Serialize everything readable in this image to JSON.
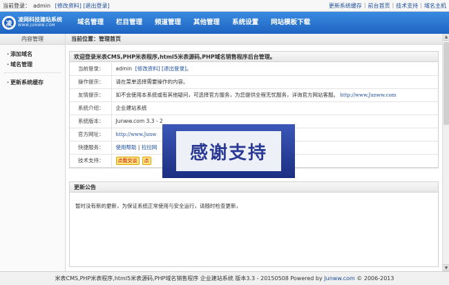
{
  "topbar": {
    "login_label": "当前登录：",
    "user": "admin",
    "edit_profile": "[修改资料]",
    "logout": "[退出登录]",
    "links": [
      "更新系统缓存",
      "前台首页",
      "技术支持",
      "域名主机"
    ]
  },
  "logo": {
    "mark": "凌",
    "name": "凌网科技建站系统",
    "url": "WWW.JUNWW.COM"
  },
  "nav": [
    "域名管理",
    "栏目管理",
    "频道管理",
    "其他管理",
    "系统设置",
    "网站模板下载"
  ],
  "sidebar": {
    "title": "内容管理",
    "items": [
      "添加域名",
      "域名管理"
    ],
    "items2": [
      "更新系统缓存"
    ]
  },
  "breadcrumb": "当前位置：管理首页",
  "welcome_panel": {
    "heading": "欢迎登录米表CMS,PHP米表程序,html5米表源码,PHP域名销售程序后台管理。",
    "rows": [
      {
        "key": "当前登录：",
        "value": "admin",
        "link1": "[修改资料]",
        "link2": "[退出登录]",
        "suffix": "。"
      },
      {
        "key": "操作提示：",
        "value": "请在菜单选择需要操作的内容。"
      },
      {
        "key": "友情提示：",
        "value": "如不会使用本系统或有其他疑问，可选择官方服务，为您提供全程无忧服务，详询官方网站客服。",
        "link": "http://www.Junww.com"
      },
      {
        "key": "系统介绍：",
        "value": "企业建站系统"
      },
      {
        "key": "系统版本：",
        "value": "Junww.com 3.3 - 2"
      },
      {
        "key": "官方网址：",
        "link": "http://www.Junw"
      },
      {
        "key": "快捷服务：",
        "link1": "使用帮助",
        "sep": "|",
        "link2": "拉拉网"
      },
      {
        "key": "技术支持：",
        "qq1": "点我交谈",
        "qq2": "点"
      }
    ]
  },
  "news_panel": {
    "heading": "更新公告",
    "text": "暂时没有新的更新，为保证系统正常使用与安全运行，请随时检查更新，"
  },
  "footer": {
    "text": "米表CMS,PHP米表程序,html5米表源码,PHP域名销售程序  企业建站系统 版本3.3 - 20150508 Powered by",
    "brand": "Junww.com",
    "copy": "© 2006-2013"
  },
  "overlay": {
    "text": "感谢支持"
  }
}
